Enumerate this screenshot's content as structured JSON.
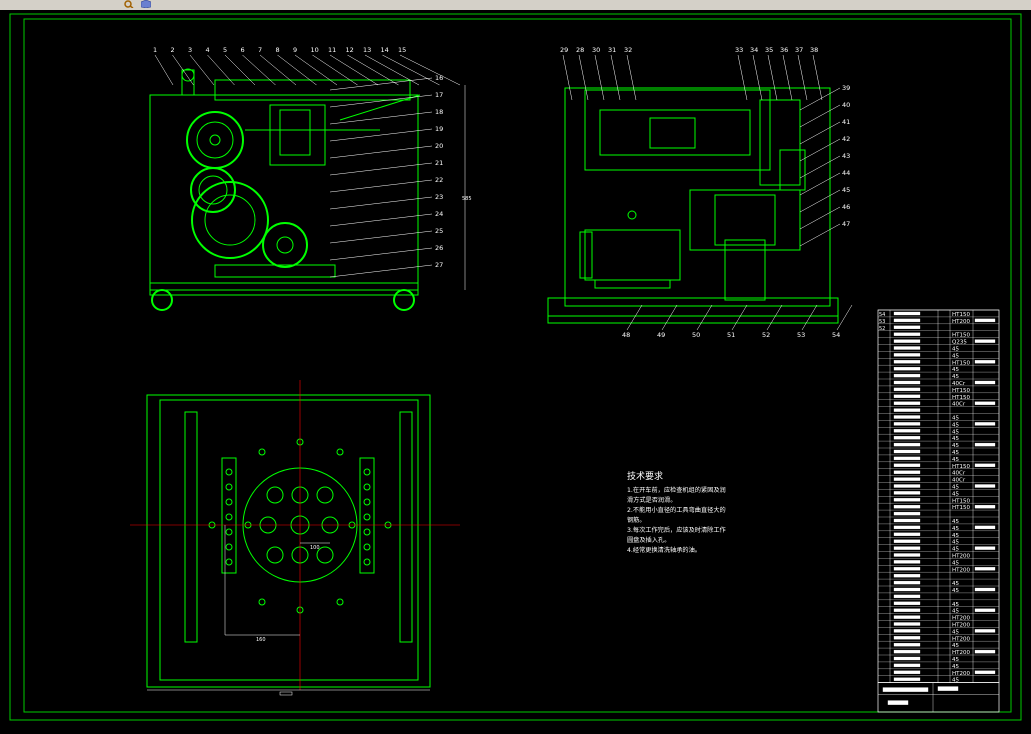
{
  "window": {
    "toolbar_icons": [
      "zoom-icon",
      "cube-icon"
    ]
  },
  "colors": {
    "background": "#000000",
    "drawing_lines": "#00ff00",
    "dimension_lines": "#ff0000",
    "text": "#ffffff",
    "frame": "#00cc00"
  },
  "drawing": {
    "front_view_part_numbers": [
      "1",
      "2",
      "3",
      "4",
      "5",
      "6",
      "7",
      "8",
      "9",
      "10",
      "11",
      "12",
      "13",
      "14",
      "15",
      "16",
      "17",
      "18",
      "19",
      "20",
      "21",
      "22",
      "23",
      "24",
      "25",
      "26",
      "27"
    ],
    "side_view_part_numbers": [
      "29",
      "28",
      "30",
      "31",
      "32",
      "33",
      "34",
      "35",
      "36",
      "37",
      "38",
      "39",
      "40",
      "41",
      "42",
      "43",
      "44",
      "45",
      "46",
      "47",
      "48",
      "49",
      "50",
      "51",
      "52",
      "53",
      "54"
    ],
    "plan_dimension_1": "100",
    "plan_dimension_2": "160",
    "overall_height_dim": "585"
  },
  "technical_requirements": {
    "title": "技术要求",
    "lines": [
      "1.在开车前，应检查机组的紧固及润",
      "滑方式是否润滑。",
      "2.不能用小直径的工具弯曲直径大的",
      "钢筋。",
      "3.每次工作完后，应该及时清除工作",
      "圆盘及插入孔。",
      "4.经常更换清洗轴承的油。"
    ]
  },
  "bom": {
    "rows": [
      {
        "no": "54",
        "material": "HT150"
      },
      {
        "no": "53",
        "material": "HT200"
      },
      {
        "no": "52",
        "material": ""
      },
      {
        "no": "",
        "material": "HT150"
      },
      {
        "no": "",
        "material": "Q235"
      },
      {
        "no": "",
        "material": "45"
      },
      {
        "no": "",
        "material": "45"
      },
      {
        "no": "",
        "material": "HT150"
      },
      {
        "no": "",
        "material": "45"
      },
      {
        "no": "",
        "material": "45"
      },
      {
        "no": "",
        "material": "40Cr"
      },
      {
        "no": "",
        "material": "HT150"
      },
      {
        "no": "",
        "material": "HT150"
      },
      {
        "no": "",
        "material": "40Cr"
      },
      {
        "no": "",
        "material": ""
      },
      {
        "no": "",
        "material": "45"
      },
      {
        "no": "",
        "material": "45"
      },
      {
        "no": "",
        "material": "45"
      },
      {
        "no": "",
        "material": "45"
      },
      {
        "no": "",
        "material": "45"
      },
      {
        "no": "",
        "material": "45"
      },
      {
        "no": "",
        "material": "45"
      },
      {
        "no": "",
        "material": "HT150"
      },
      {
        "no": "",
        "material": "40Cr"
      },
      {
        "no": "",
        "material": "40Cr"
      },
      {
        "no": "",
        "material": "45"
      },
      {
        "no": "",
        "material": "45"
      },
      {
        "no": "",
        "material": "HT150"
      },
      {
        "no": "",
        "material": "HT150"
      },
      {
        "no": "",
        "material": ""
      },
      {
        "no": "",
        "material": "45"
      },
      {
        "no": "",
        "material": "45"
      },
      {
        "no": "",
        "material": "45"
      },
      {
        "no": "",
        "material": "45"
      },
      {
        "no": "",
        "material": "45"
      },
      {
        "no": "",
        "material": "HT200"
      },
      {
        "no": "",
        "material": "45"
      },
      {
        "no": "",
        "material": "HT200"
      },
      {
        "no": "",
        "material": ""
      },
      {
        "no": "",
        "material": "45"
      },
      {
        "no": "",
        "material": "45"
      },
      {
        "no": "",
        "material": ""
      },
      {
        "no": "",
        "material": "45"
      },
      {
        "no": "",
        "material": "45"
      },
      {
        "no": "",
        "material": "HT200"
      },
      {
        "no": "",
        "material": "HT200"
      },
      {
        "no": "",
        "material": "45"
      },
      {
        "no": "",
        "material": "HT200"
      },
      {
        "no": "",
        "material": "45"
      },
      {
        "no": "",
        "material": "HT200"
      },
      {
        "no": "",
        "material": "45"
      },
      {
        "no": "",
        "material": "45"
      },
      {
        "no": "",
        "material": "HT200"
      },
      {
        "no": "",
        "material": "45"
      }
    ]
  }
}
